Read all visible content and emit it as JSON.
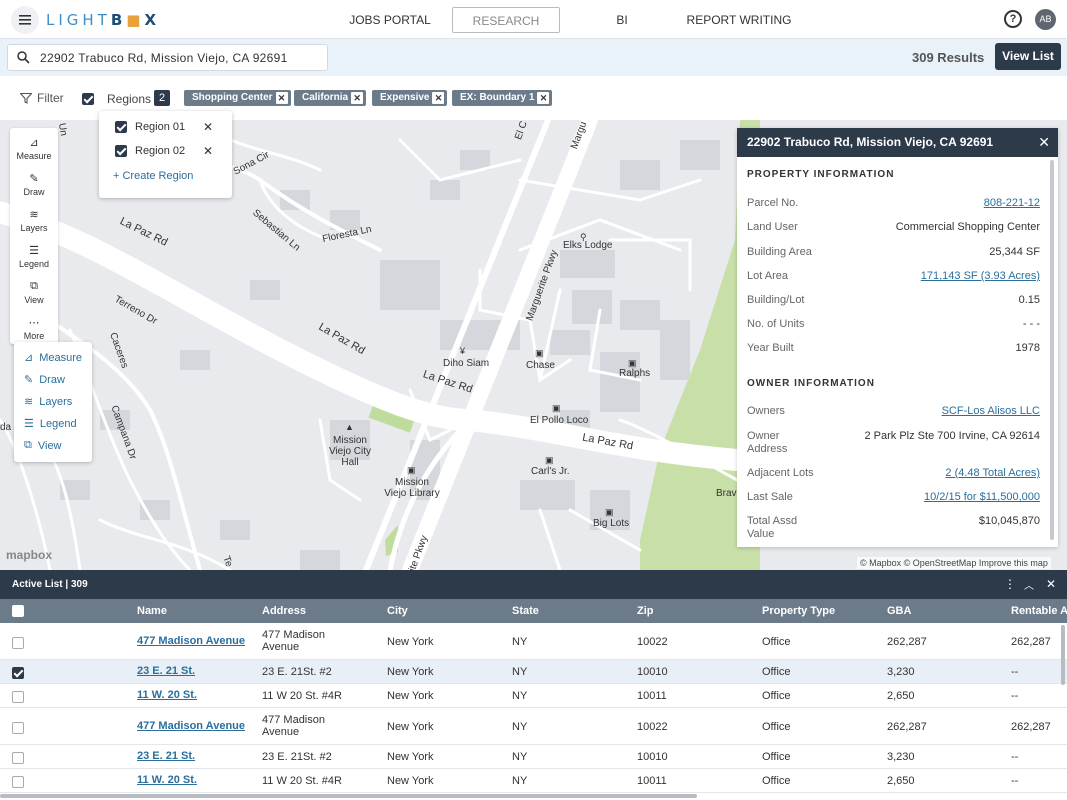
{
  "nav": {
    "logo_a": "LIGHT",
    "logo_b": "B",
    "logo_c": "X",
    "links": [
      "JOBS PORTAL",
      "RESEARCH",
      "BI",
      "REPORT WRITING"
    ],
    "active_link": "RESEARCH",
    "avatar": "AB"
  },
  "search": {
    "value": "22902 Trabuco Rd, Mission Viejo, CA 92691"
  },
  "results": {
    "text": "309 Results",
    "view_list": "View List"
  },
  "filters": {
    "filter_label": "Filter",
    "regions_label": "Regions",
    "regions_count": "2",
    "chips": [
      "Shopping Center",
      "California",
      "Expensive",
      "EX: Boundary 1"
    ]
  },
  "regions_popup": {
    "items": [
      "Region 01",
      "Region 02"
    ],
    "create": "Create Region"
  },
  "tools": {
    "items": [
      "Measure",
      "Draw",
      "Layers",
      "Legend",
      "View",
      "More"
    ],
    "popup": [
      "Measure",
      "Draw",
      "Layers",
      "Legend",
      "View"
    ]
  },
  "map": {
    "labels": {
      "sona_cir": "Sona Cir",
      "la_paz_1": "La Paz Rd",
      "la_paz_2": "La Paz Rd",
      "la_paz_3": "La Paz Rd",
      "la_paz_4": "La Paz Rd",
      "sebastian": "Sebastian Ln",
      "floresta": "Floresta Ln",
      "terreno": "Terreno Dr",
      "caceres": "Caceres",
      "campana": "Campana Dr",
      "marguerite": "Marguerite Pkwy",
      "marguerite2": "Margu",
      "marguerite3": "ite Pkwy",
      "elks": "Elks Lodge",
      "diho": "Diho Siam",
      "chase": "Chase",
      "ralphs": "Ralphs",
      "el_pollo": "El Pollo Loco",
      "carls": "Carl's Jr.",
      "city_hall": "Mission Viejo City Hall",
      "library": "Mission Viejo Library",
      "big_lots": "Big Lots",
      "bravo": "Brav",
      "el_c": "El C",
      "un": "Un",
      "te": "Te",
      "da": "da L"
    },
    "mapbox_logo": "mapbox",
    "attribution": "© Mapbox © OpenStreetMap  Improve this map"
  },
  "property": {
    "title": "22902 Trabuco Rd, Mission Viejo, CA 92691",
    "section1": "PROPERTY INFORMATION",
    "section2": "OWNER INFORMATION",
    "rows1": [
      {
        "label": "Parcel No.",
        "value": "808-221-12",
        "link": true
      },
      {
        "label": "Land User",
        "value": "Commercial Shopping Center",
        "link": false
      },
      {
        "label": "Building Area",
        "value": "25,344 SF",
        "link": false
      },
      {
        "label": "Lot Area",
        "value": "171,143 SF (3.93 Acres)",
        "link": true
      },
      {
        "label": "Building/Lot",
        "value": "0.15",
        "link": false
      },
      {
        "label": "No. of Units",
        "value": "- - -",
        "link": false
      },
      {
        "label": "Year Built",
        "value": "1978",
        "link": false
      }
    ],
    "rows2": [
      {
        "label": "Owners",
        "value": "SCF-Los Alisos LLC",
        "link": true
      },
      {
        "label": "Owner Address",
        "value": "2 Park Plz Ste 700 Irvine, CA 92614",
        "link": false
      },
      {
        "label": "Adjacent Lots",
        "value": "2 (4.48 Total Acres)",
        "link": true
      },
      {
        "label": "Last Sale",
        "value": "10/2/15 for $11,500,000",
        "link": true
      },
      {
        "label": "Total Assd Value",
        "value": "$10,045,870",
        "link": false
      }
    ]
  },
  "list": {
    "title": "Active List",
    "separator": "|",
    "count": "309",
    "columns": [
      "Name",
      "Address",
      "City",
      "State",
      "Zip",
      "Property Type",
      "GBA",
      "Rentable A"
    ],
    "rows": [
      {
        "checked": false,
        "name": "477 Madison Avenue",
        "address": "477 Madison Avenue",
        "city": "New York",
        "state": "NY",
        "zip": "10022",
        "type": "Office",
        "gba": "262,287",
        "rentable": "262,287"
      },
      {
        "checked": true,
        "name": "23 E. 21 St.",
        "address": "23 E. 21St. #2",
        "city": "New York",
        "state": "NY",
        "zip": "10010",
        "type": "Office",
        "gba": "3,230",
        "rentable": "--"
      },
      {
        "checked": false,
        "name": "11 W. 20 St.",
        "address": "11 W 20 St. #4R",
        "city": "New York",
        "state": "NY",
        "zip": "10011",
        "type": "Office",
        "gba": "2,650",
        "rentable": "--"
      },
      {
        "checked": false,
        "name": "477 Madison Avenue",
        "address": "477 Madison Avenue",
        "city": "New York",
        "state": "NY",
        "zip": "10022",
        "type": "Office",
        "gba": "262,287",
        "rentable": "262,287"
      },
      {
        "checked": false,
        "name": "23 E. 21 St.",
        "address": "23 E. 21St. #2",
        "city": "New York",
        "state": "NY",
        "zip": "10010",
        "type": "Office",
        "gba": "3,230",
        "rentable": "--"
      },
      {
        "checked": false,
        "name": "11 W. 20 St.",
        "address": "11 W 20 St. #4R",
        "city": "New York",
        "state": "NY",
        "zip": "10011",
        "type": "Office",
        "gba": "2,650",
        "rentable": "--"
      }
    ]
  },
  "colors": {
    "dark": "#2d3a4a",
    "accent": "#3b8fc8",
    "link": "#2a6f9c",
    "header_gray": "#6b7b8a",
    "park_green": "#c8dfa8"
  }
}
